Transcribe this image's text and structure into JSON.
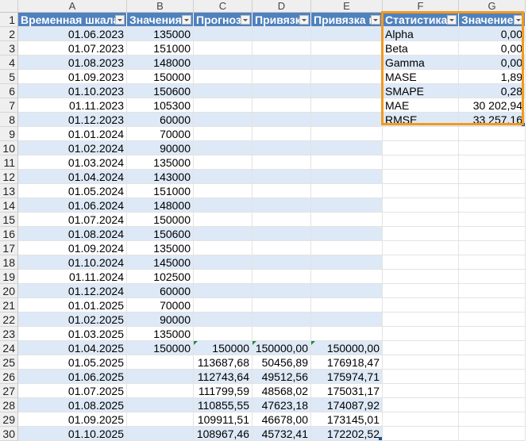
{
  "columns": [
    "A",
    "B",
    "C",
    "D",
    "E",
    "F",
    "G"
  ],
  "headers": {
    "A": "Временная шкала",
    "B": "Значения",
    "C": "Прогноз",
    "D": "Привязка",
    "E": "Привязка в",
    "F": "Статистика",
    "G": "Значение"
  },
  "rows": [
    {
      "n": "2",
      "a": "01.06.2023",
      "b": "135000"
    },
    {
      "n": "3",
      "a": "01.07.2023",
      "b": "151000"
    },
    {
      "n": "4",
      "a": "01.08.2023",
      "b": "148000"
    },
    {
      "n": "5",
      "a": "01.09.2023",
      "b": "150000"
    },
    {
      "n": "6",
      "a": "01.10.2023",
      "b": "150600"
    },
    {
      "n": "7",
      "a": "01.11.2023",
      "b": "105300"
    },
    {
      "n": "8",
      "a": "01.12.2023",
      "b": "60000"
    },
    {
      "n": "9",
      "a": "01.01.2024",
      "b": "70000"
    },
    {
      "n": "10",
      "a": "01.02.2024",
      "b": "90000"
    },
    {
      "n": "11",
      "a": "01.03.2024",
      "b": "135000"
    },
    {
      "n": "12",
      "a": "01.04.2024",
      "b": "143000"
    },
    {
      "n": "13",
      "a": "01.05.2024",
      "b": "151000"
    },
    {
      "n": "14",
      "a": "01.06.2024",
      "b": "148000"
    },
    {
      "n": "15",
      "a": "01.07.2024",
      "b": "150000"
    },
    {
      "n": "16",
      "a": "01.08.2024",
      "b": "150600"
    },
    {
      "n": "17",
      "a": "01.09.2024",
      "b": "135000"
    },
    {
      "n": "18",
      "a": "01.10.2024",
      "b": "145000"
    },
    {
      "n": "19",
      "a": "01.11.2024",
      "b": "102500"
    },
    {
      "n": "20",
      "a": "01.12.2024",
      "b": "60000"
    },
    {
      "n": "21",
      "a": "01.01.2025",
      "b": "70000"
    },
    {
      "n": "22",
      "a": "01.02.2025",
      "b": "90000"
    },
    {
      "n": "23",
      "a": "01.03.2025",
      "b": "135000"
    },
    {
      "n": "24",
      "a": "01.04.2025",
      "b": "150000",
      "c": "150000",
      "d": "150000,00",
      "e": "150000,00"
    },
    {
      "n": "25",
      "a": "01.05.2025",
      "c": "113687,68",
      "d": "50456,89",
      "e": "176918,47"
    },
    {
      "n": "26",
      "a": "01.06.2025",
      "c": "112743,64",
      "d": "49512,56",
      "e": "175974,71"
    },
    {
      "n": "27",
      "a": "01.07.2025",
      "c": "111799,59",
      "d": "48568,02",
      "e": "175031,17"
    },
    {
      "n": "28",
      "a": "01.08.2025",
      "c": "110855,55",
      "d": "47623,18",
      "e": "174087,92"
    },
    {
      "n": "29",
      "a": "01.09.2025",
      "c": "109911,51",
      "d": "46678,00",
      "e": "173145,01"
    },
    {
      "n": "30",
      "a": "01.10.2025",
      "c": "108967,46",
      "d": "45732,41",
      "e": "172202,52"
    }
  ],
  "stats": [
    {
      "name": "Alpha",
      "value": "0,00"
    },
    {
      "name": "Beta",
      "value": "0,00"
    },
    {
      "name": "Gamma",
      "value": "0,00"
    },
    {
      "name": "MASE",
      "value": "1,89"
    },
    {
      "name": "SMAPE",
      "value": "0,28"
    },
    {
      "name": "MAE",
      "value": "30 202,94"
    },
    {
      "name": "RMSE",
      "value": "33 257,16"
    }
  ],
  "colors": {
    "header_fill": "#4f81bd",
    "band_fill": "#dde9f6",
    "highlight_border": "#f39a1e"
  }
}
